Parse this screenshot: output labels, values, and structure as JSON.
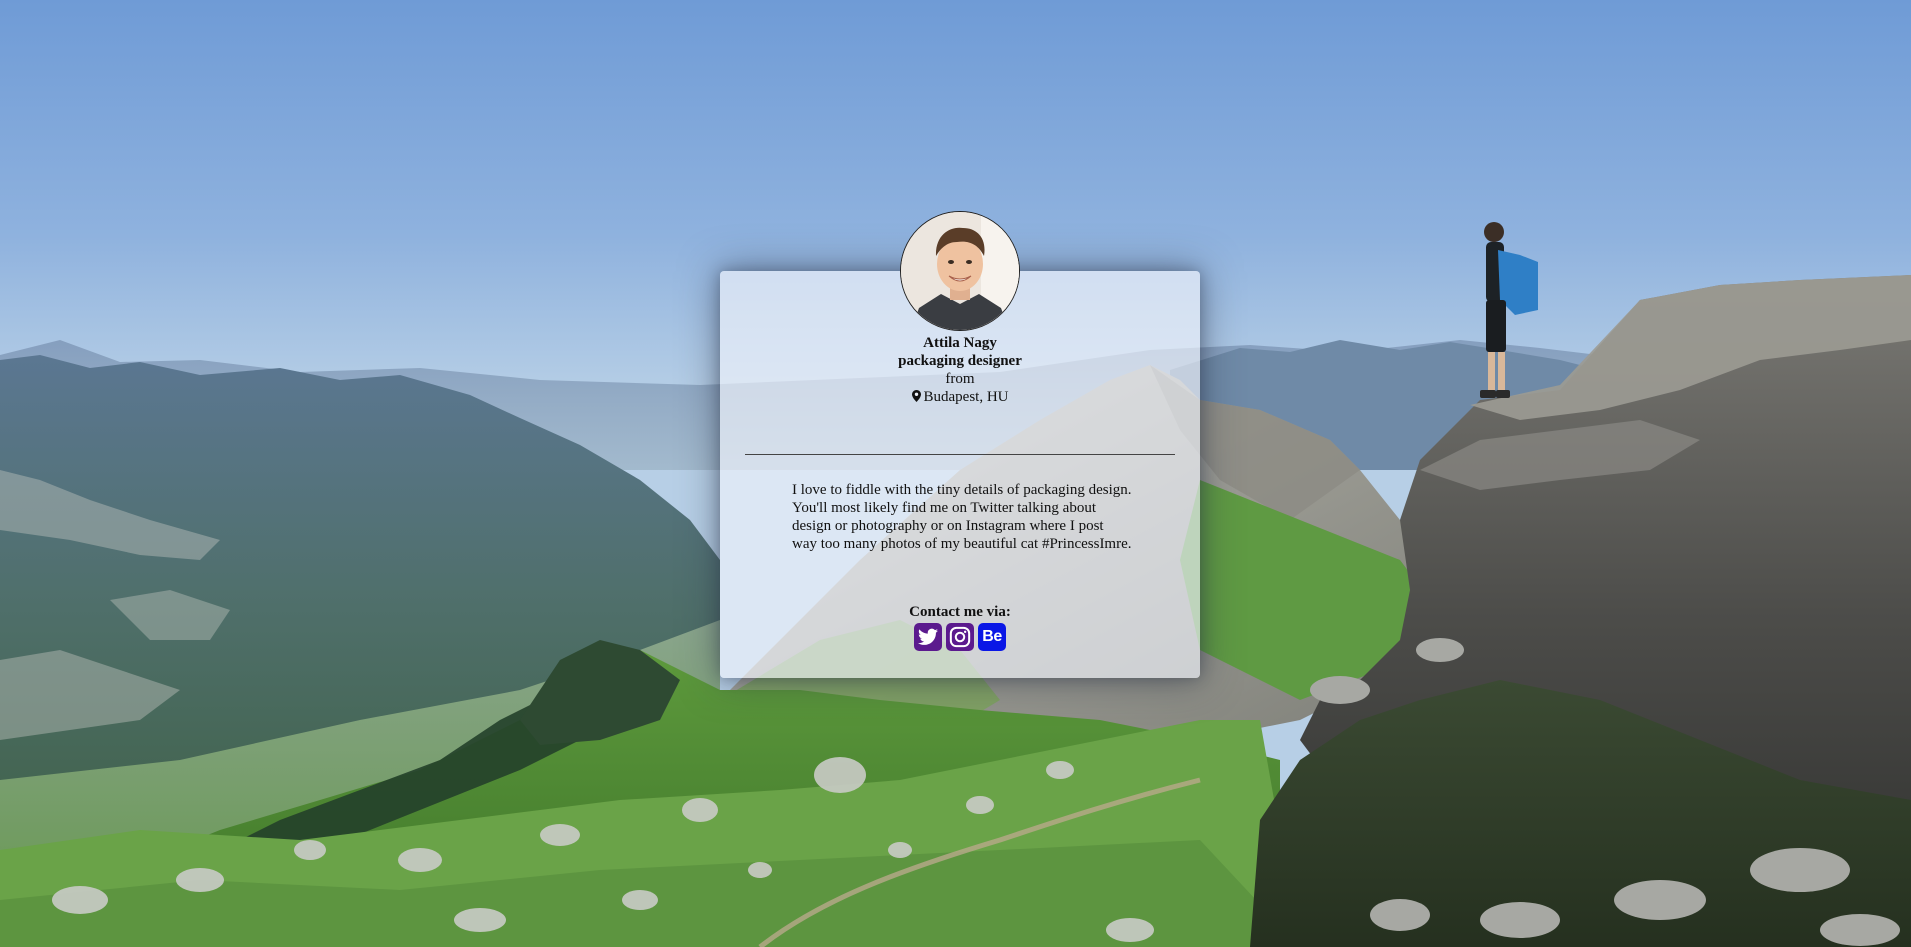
{
  "profile": {
    "name": "Attila Nagy",
    "title": "packaging designer",
    "from_label": "from",
    "location": "Budapest, HU",
    "bio": "I love to fiddle with the tiny details of packaging design. You'll most likely find me on Twitter talking about design or photography or on Instagram where I post way too many photos of my beautiful cat #PrincessImre."
  },
  "contact": {
    "label": "Contact me via:",
    "links": [
      {
        "name": "Twitter",
        "icon": "twitter-icon",
        "color": "#5b1a8e"
      },
      {
        "name": "Instagram",
        "icon": "instagram-icon",
        "color": "#5b1a8e"
      },
      {
        "name": "Behance",
        "icon": "behance-icon",
        "color": "#0a17e6",
        "text": "Be"
      }
    ]
  },
  "icons": {
    "location": "map-pin-icon"
  }
}
